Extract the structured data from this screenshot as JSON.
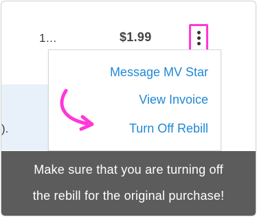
{
  "row": {
    "truncated_cell": "1...",
    "price": "$1.99",
    "left_fragment": ")."
  },
  "menu": {
    "items": [
      {
        "label": "Message MV Star"
      },
      {
        "label": "View Invoice"
      },
      {
        "label": "Turn Off Rebill"
      }
    ]
  },
  "caption": {
    "line1": "Make sure that you are turning off",
    "line2": "the rebill for the original purchase!"
  },
  "colors": {
    "highlight": "#ff37d8",
    "link": "#1f88d6",
    "caption_bg": "#5c5c5c"
  },
  "icons": {
    "more": "kebab-menu-icon",
    "pointer": "curved-arrow-icon"
  }
}
